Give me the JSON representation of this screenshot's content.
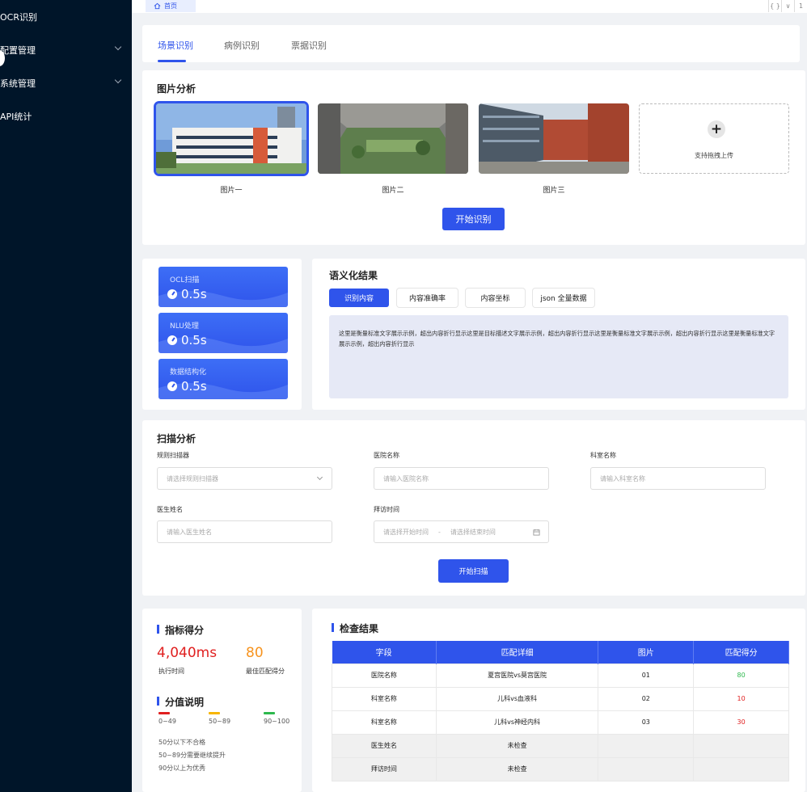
{
  "sidebar": {
    "items": [
      {
        "label": "OCR识别"
      },
      {
        "label": "配置管理"
      },
      {
        "label": "系统管理"
      },
      {
        "label": "API统计"
      }
    ]
  },
  "topbar": {
    "home_tab": "首页",
    "right_icons": [
      "{ }",
      "∨",
      "1"
    ]
  },
  "tabs": [
    {
      "label": "场景识别",
      "active": true
    },
    {
      "label": "病例识别",
      "active": false
    },
    {
      "label": "票据识别",
      "active": false
    }
  ],
  "image_analysis": {
    "title": "图片分析",
    "images": [
      {
        "label": "图片一",
        "selected": true
      },
      {
        "label": "图片二",
        "selected": false
      },
      {
        "label": "图片三",
        "selected": false
      }
    ],
    "upload_text": "支持拖拽上传",
    "start_button": "开始识别"
  },
  "timings": [
    {
      "label": "OCL扫描",
      "value": "0.5s"
    },
    {
      "label": "NLU处理",
      "value": "0.5s"
    },
    {
      "label": "数据结构化",
      "value": "0.5s"
    }
  ],
  "semantic": {
    "title": "语义化结果",
    "buttons": [
      {
        "label": "识别内容",
        "active": true
      },
      {
        "label": "内容准确率",
        "active": false
      },
      {
        "label": "内容坐标",
        "active": false
      },
      {
        "label": "json 全量数据",
        "active": false
      }
    ],
    "content": "这里是衡量标准文字展示示例，超出内容折行显示这里是目标描述文字展示示例，超出内容折行显示这里是衡量标准文字展示示例，超出内容折行显示这里是衡量标准文字展示示例，超出内容折行显示"
  },
  "scan": {
    "title": "扫描分析",
    "fields": {
      "scanner": {
        "label": "规则扫描器",
        "placeholder": "请选择规则扫描器"
      },
      "hospital": {
        "label": "医院名称",
        "placeholder": "请输入医院名称"
      },
      "department": {
        "label": "科室名称",
        "placeholder": "请输入科室名称"
      },
      "doctor": {
        "label": "医生姓名",
        "placeholder": "请输入医生姓名"
      },
      "visit": {
        "label": "拜访时间",
        "start_placeholder": "请选择开始时间",
        "separator": "-",
        "end_placeholder": "请选择结束时间"
      }
    },
    "start_button": "开始扫描"
  },
  "score": {
    "title": "指标得分",
    "exec_time": "4,040ms",
    "exec_time_label": "执行时间",
    "best_score": "80",
    "best_score_label": "最佳匹配得分",
    "legend_title": "分值说明",
    "ranges": [
      {
        "label": "0~49",
        "color": "#e02020"
      },
      {
        "label": "50~89",
        "color": "#f7b500"
      },
      {
        "label": "90~100",
        "color": "#2db84d"
      }
    ],
    "notes": [
      "50分以下不合格",
      "50~89分需要继续提升",
      "90分以上为优秀"
    ]
  },
  "check": {
    "title": "检查结果",
    "columns": [
      "字段",
      "匹配详细",
      "图片",
      "匹配得分"
    ],
    "rows": [
      {
        "field": "医院名称",
        "detail": "夏宫医院vs莫宫医院",
        "image": "01",
        "score": "80",
        "score_color": "#2db84d",
        "grey": false
      },
      {
        "field": "科室名称",
        "detail": "儿科vs血液科",
        "image": "02",
        "score": "10",
        "score_color": "#e02020",
        "grey": false
      },
      {
        "field": "科室名称",
        "detail": "儿科vs神经内科",
        "image": "03",
        "score": "30",
        "score_color": "#e02020",
        "grey": false
      },
      {
        "field": "医生姓名",
        "detail": "未检查",
        "image": "",
        "score": "",
        "score_color": "#222",
        "grey": true
      },
      {
        "field": "拜访时间",
        "detail": "未检查",
        "image": "",
        "score": "",
        "score_color": "#222",
        "grey": true
      }
    ]
  },
  "colors": {
    "primary": "#2f54eb",
    "sidebar_bg": "#001529",
    "exec_time_color": "#e02020",
    "best_score_color": "#f7931e"
  }
}
